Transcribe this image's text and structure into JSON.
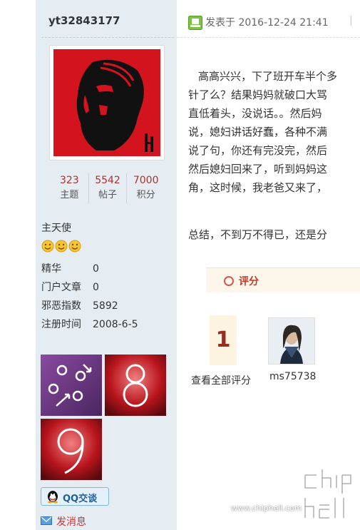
{
  "user": {
    "username": "yt32843177",
    "stats": [
      {
        "value": "323",
        "label": "主题"
      },
      {
        "value": "5542",
        "label": "帖子"
      },
      {
        "value": "7000",
        "label": "积分"
      }
    ],
    "rank": "主天使",
    "info": [
      {
        "key": "精华",
        "value": "0"
      },
      {
        "key": "门户文章",
        "value": "0"
      },
      {
        "key": "邪恶指数",
        "value": "5892"
      },
      {
        "key": "注册时间",
        "value": "2008-6-5"
      }
    ],
    "qq_label": "QQ交谈",
    "send_message_label": "发消息"
  },
  "post": {
    "posted_at": "发表于 2016-12-24 21:41",
    "separator": "|",
    "lines": [
      "高高兴兴，下了班开车半个多",
      "针了么？结果妈妈就破口大骂",
      "直低着头，没说话。。然后妈",
      "说，媳妇讲话好蠢，各种不满",
      "说了句，你还有完没完，然后",
      "然后媳妇回来了，听到妈妈这",
      "角，这时候，我老爸又来了，"
    ],
    "summary": "总结，不到万不得已，还是分"
  },
  "rating": {
    "title": "评分",
    "count": "1",
    "view_all": "查看全部评分",
    "rater": "ms75738"
  },
  "watermark": {
    "url": "www.chiphell.com"
  },
  "colors": {
    "sidebar_bg": "#e5edf2",
    "stat_number": "#aa3333",
    "rate_accent": "#c0392b"
  }
}
